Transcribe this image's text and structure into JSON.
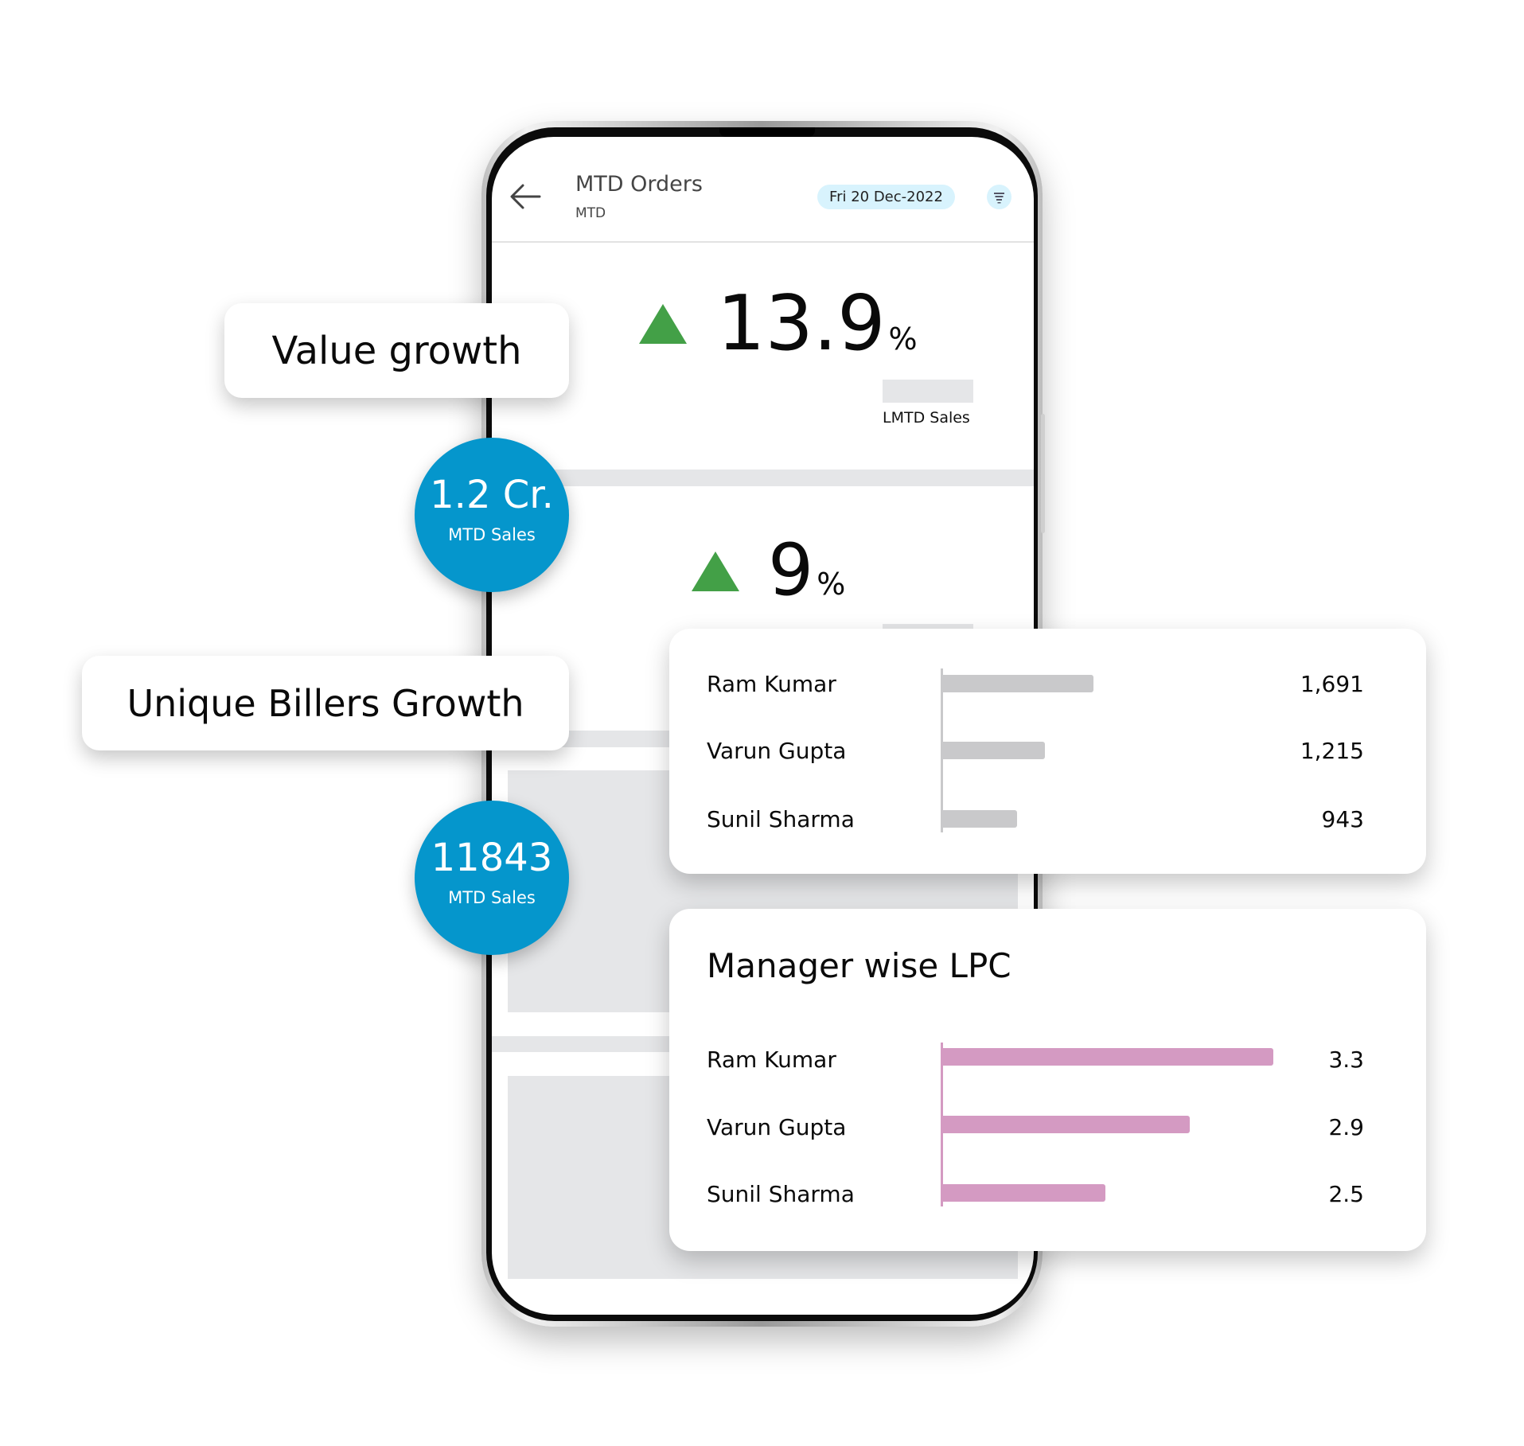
{
  "app": {
    "header": {
      "title": "MTD Orders",
      "subtitle": "MTD",
      "date": "Fri 20 Dec-2022",
      "back_icon": "arrow-left-icon",
      "filter_icon": "filter-icon"
    },
    "stats": [
      {
        "value": "13.9",
        "unit": "%",
        "trend": "up",
        "legend": "LMTD Sales"
      },
      {
        "value": "9",
        "unit": "%",
        "trend": "up"
      }
    ]
  },
  "callouts": [
    {
      "label": "Value growth"
    },
    {
      "label": "Unique Billers Growth"
    }
  ],
  "bubbles": [
    {
      "value": "1.2 Cr.",
      "label": "MTD Sales"
    },
    {
      "value": "11843",
      "label": "MTD Sales"
    }
  ],
  "colors": {
    "accent_blue": "#0596cc",
    "trend_up": "#43a047",
    "bar_gray": "#c9c9cb",
    "bar_pink": "#d49ac2",
    "pill_bg": "#d8f3fd"
  },
  "chart_data": [
    {
      "type": "bar",
      "orientation": "horizontal",
      "title": "",
      "categories": [
        "Ram Kumar",
        "Varun Gupta",
        "Sunil Sharma"
      ],
      "values": [
        1691,
        1215,
        943
      ],
      "value_labels": [
        "1,691",
        "1,215",
        "943"
      ],
      "xlim": [
        220,
        4120
      ],
      "color": "#c9c9cb",
      "grid": false,
      "legend": "none"
    },
    {
      "type": "bar",
      "orientation": "horizontal",
      "title": "Manager wise LPC",
      "categories": [
        "Ram Kumar",
        "Varun Gupta",
        "Sunil Sharma"
      ],
      "values": [
        3.3,
        2.9,
        2.5
      ],
      "value_labels": [
        "3.3",
        "2.9",
        "2.5"
      ],
      "xlim": [
        1.73,
        3.62
      ],
      "color": "#d49ac2",
      "grid": false,
      "legend": "none"
    }
  ]
}
